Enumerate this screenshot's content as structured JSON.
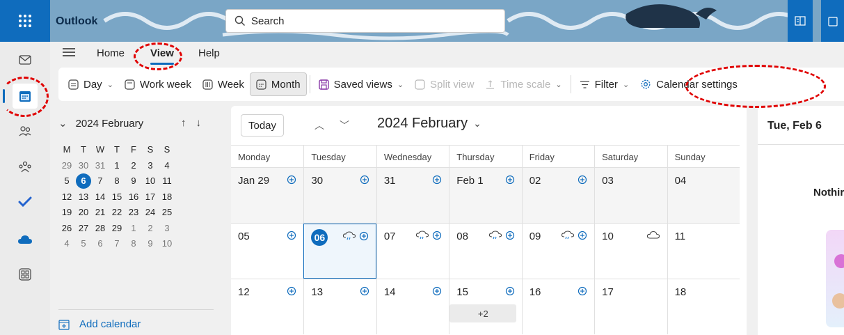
{
  "app": {
    "name": "Outlook"
  },
  "search": {
    "placeholder": "Search"
  },
  "tabs": {
    "home": "Home",
    "view": "View",
    "help": "Help"
  },
  "toolbar": {
    "day": "Day",
    "work_week": "Work week",
    "week": "Week",
    "month": "Month",
    "saved_views": "Saved views",
    "split_view": "Split view",
    "time_scale": "Time scale",
    "filter": "Filter",
    "calendar_settings": "Calendar settings"
  },
  "mini_calendar": {
    "title": "2024 February",
    "weekdays": [
      "M",
      "T",
      "W",
      "T",
      "F",
      "S",
      "S"
    ],
    "weeks": [
      [
        "29",
        "30",
        "31",
        "1",
        "2",
        "3",
        "4"
      ],
      [
        "5",
        "6",
        "7",
        "8",
        "9",
        "10",
        "11"
      ],
      [
        "12",
        "13",
        "14",
        "15",
        "16",
        "17",
        "18"
      ],
      [
        "19",
        "20",
        "21",
        "22",
        "23",
        "24",
        "25"
      ],
      [
        "26",
        "27",
        "28",
        "29",
        "1",
        "2",
        "3"
      ],
      [
        "4",
        "5",
        "6",
        "7",
        "8",
        "9",
        "10"
      ]
    ],
    "today": "6",
    "add_calendar": "Add calendar"
  },
  "calendar": {
    "today_button": "Today",
    "title": "2024 February",
    "weekdays": [
      "Monday",
      "Tuesday",
      "Wednesday",
      "Thursday",
      "Friday",
      "Saturday",
      "Sunday"
    ],
    "weeks": [
      [
        "Jan 29",
        "30",
        "31",
        "Feb 1",
        "02",
        "03",
        "04"
      ],
      [
        "05",
        "06",
        "07",
        "08",
        "09",
        "10",
        "11"
      ],
      [
        "12",
        "13",
        "14",
        "15",
        "16",
        "17",
        "18"
      ]
    ],
    "more_events": "+2"
  },
  "right_pane": {
    "date": "Tue, Feb 6",
    "empty_text": "Nothir"
  },
  "colors": {
    "accent": "#0f6cbd",
    "annotation": "#e00000"
  }
}
